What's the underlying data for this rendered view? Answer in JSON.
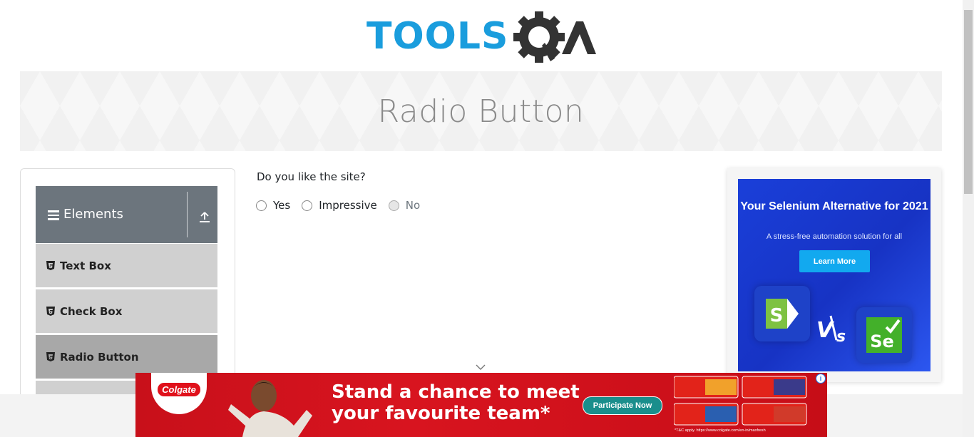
{
  "header": {
    "logo_text_left": "TOOLS",
    "logo_text_right": "QA",
    "logo_colors": {
      "tools": "#1a9ddd",
      "qa": "#333333"
    }
  },
  "banner": {
    "title": "Radio Button"
  },
  "sidebar": {
    "group": {
      "title": "Elements",
      "menu_icon": "hamburger-icon",
      "collapse_icon": "upload-icon"
    },
    "items": [
      {
        "label": "Text Box",
        "icon": "html5-icon",
        "active": false
      },
      {
        "label": "Check Box",
        "icon": "html5-icon",
        "active": false
      },
      {
        "label": "Radio Button",
        "icon": "html5-icon",
        "active": true
      }
    ]
  },
  "main": {
    "question": "Do you like the site?",
    "options": [
      {
        "label": "Yes",
        "checked": false,
        "disabled": false
      },
      {
        "label": "Impressive",
        "checked": false,
        "disabled": false
      },
      {
        "label": "No",
        "checked": false,
        "disabled": true
      }
    ]
  },
  "right_ad": {
    "headline": "Your Selenium Alternative for 2021",
    "sub": "A stress-free automation solution for all",
    "button": "Learn More",
    "vs_text": "V/S",
    "logo_left": "S",
    "logo_right": "Se"
  },
  "bottom_ad": {
    "brand": "Colgate",
    "headline_line1": "Stand a chance to meet",
    "headline_line2": "your favourite team*",
    "cta": "Participate Now",
    "terms": "*T&C apply. https://www.colgate.com/en-in/maxfresh",
    "info_icon": "i"
  },
  "colors": {
    "sidebar_header": "#6c757d",
    "menu_item": "#d0d0d0",
    "menu_item_active": "#a8a8a8",
    "ad_blue": "#1a3fd9",
    "ad_red": "#d8141f"
  }
}
